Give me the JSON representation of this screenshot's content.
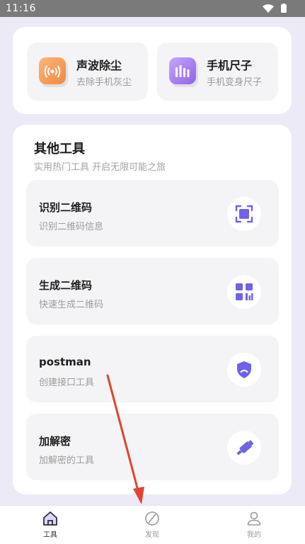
{
  "status_bar": {
    "time": "11:16"
  },
  "top_tools": [
    {
      "title": "声波除尘",
      "subtitle": "去除手机灰尘",
      "icon": "sound-wave-icon",
      "color": "#f59a52"
    },
    {
      "title": "手机尺子",
      "subtitle": "手机变身尺子",
      "icon": "ruler-icon",
      "color": "#a57bef"
    }
  ],
  "other_tools": {
    "title": "其他工具",
    "subtitle": "实用热门工具 开启无限可能之旅",
    "items": [
      {
        "title": "识别二维码",
        "subtitle": "识别二维码信息",
        "icon": "scan-icon"
      },
      {
        "title": "生成二维码",
        "subtitle": "快速生成二维码",
        "icon": "qr-code-icon"
      },
      {
        "title": "postman",
        "subtitle": "创建接口工具",
        "icon": "shield-icon"
      },
      {
        "title": "加解密",
        "subtitle": "加解密的工具",
        "icon": "usb-key-icon"
      }
    ]
  },
  "tabbar": {
    "items": [
      {
        "label": "工具",
        "icon": "home-icon",
        "active": true
      },
      {
        "label": "发现",
        "icon": "compass-icon",
        "active": false
      },
      {
        "label": "我的",
        "icon": "user-icon",
        "active": false
      }
    ]
  },
  "colors": {
    "accent": "#6e63e6",
    "background": "#ebeaf6",
    "annotation": "#e0442f"
  }
}
